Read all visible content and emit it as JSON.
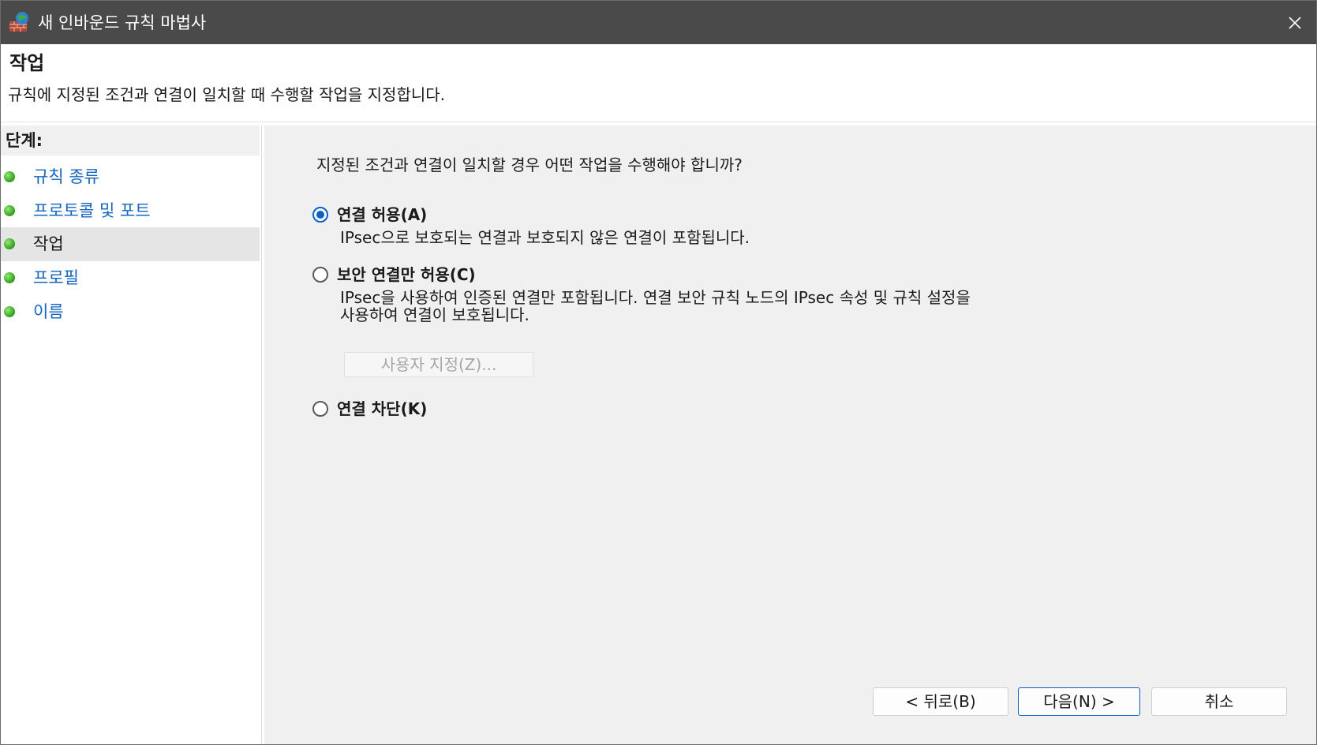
{
  "window": {
    "title": "새 인바운드 규칙 마법사",
    "close_icon": "close-icon",
    "app_icon": "firewall-icon"
  },
  "header": {
    "title": "작업",
    "description": "규칙에 지정된 조건과 연결이 일치할 때 수행할 작업을 지정합니다."
  },
  "steps": {
    "title": "단계:",
    "items": [
      {
        "label": "규칙 종류",
        "active": false
      },
      {
        "label": "프로토콜 및 포트",
        "active": false
      },
      {
        "label": "작업",
        "active": true
      },
      {
        "label": "프로필",
        "active": false
      },
      {
        "label": "이름",
        "active": false
      }
    ]
  },
  "main": {
    "question": "지정된 조건과 연결이 일치할 경우 어떤 작업을 수행해야 합니까?",
    "options": [
      {
        "label": "연결 허용(A)",
        "description": "IPsec으로 보호되는 연결과 보호되지 않은 연결이 포함됩니다.",
        "checked": true
      },
      {
        "label": "보안 연결만 허용(C)",
        "description_line1": "IPsec을 사용하여 인증된 연결만 포함됩니다. 연결 보안 규칙 노드의 IPsec 속성 및 규칙 설정을",
        "description_line2": "사용하여 연결이 보호됩니다.",
        "checked": false
      },
      {
        "label": "연결 차단(K)",
        "checked": false
      }
    ],
    "customize_label": "사용자 지정(Z)..."
  },
  "footer": {
    "back_label": "< 뒤로(B)",
    "next_label": "다음(N) >",
    "cancel_label": "취소"
  },
  "colors": {
    "titlebar": "#4a4a4a",
    "accent": "#0a5fc4",
    "link": "#1565c0",
    "panel": "#f0f0f0"
  }
}
